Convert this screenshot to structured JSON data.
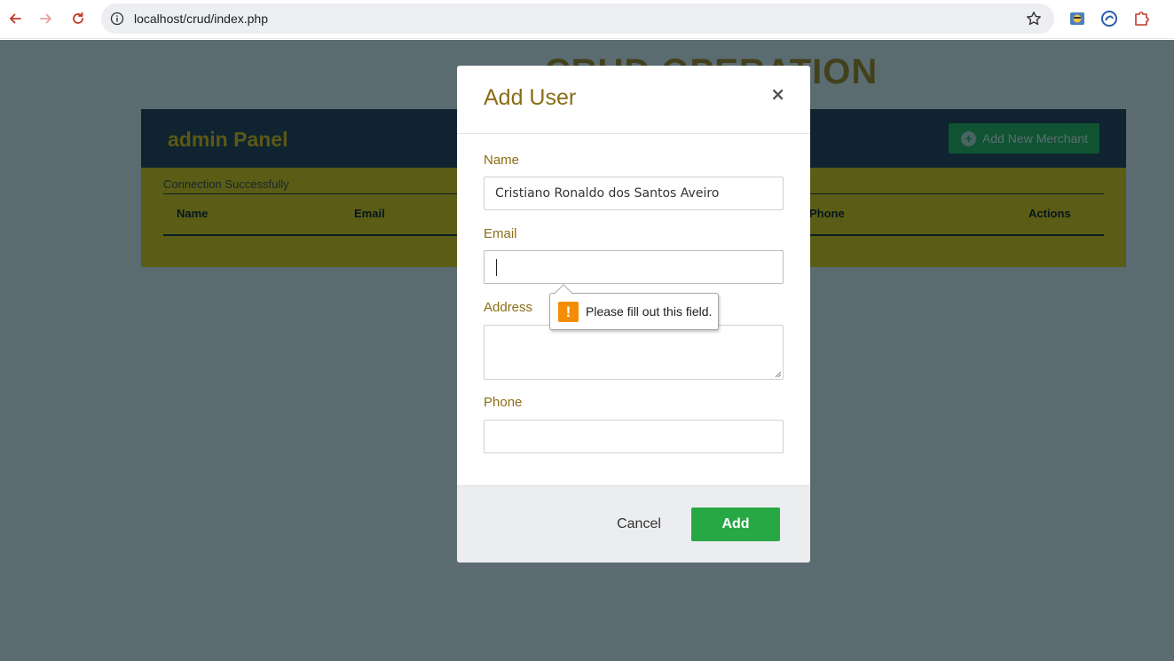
{
  "browser": {
    "url": "localhost/crud/index.php"
  },
  "page": {
    "title": "CRUD OPERATION",
    "panel_title": "admin Panel",
    "add_merchant_label": "Add New Merchant",
    "connection_message": "Connection Successfully",
    "table_headers": [
      "Name",
      "Email",
      "Phone",
      "Actions"
    ]
  },
  "modal": {
    "title": "Add User",
    "close_label": "×",
    "fields": {
      "name_label": "Name",
      "name_value": "Cristiano Ronaldo dos Santos Aveiro",
      "email_label": "Email",
      "email_value": "",
      "address_label": "Address",
      "phone_label": "Phone"
    },
    "cancel_label": "Cancel",
    "add_label": "Add"
  },
  "validation": {
    "message": "Please fill out this field.",
    "icon": "!"
  },
  "colors": {
    "accent": "#8b6d16",
    "add_button": "#28a745",
    "panel": "#ffd000",
    "panel_header": "#2b3648"
  }
}
